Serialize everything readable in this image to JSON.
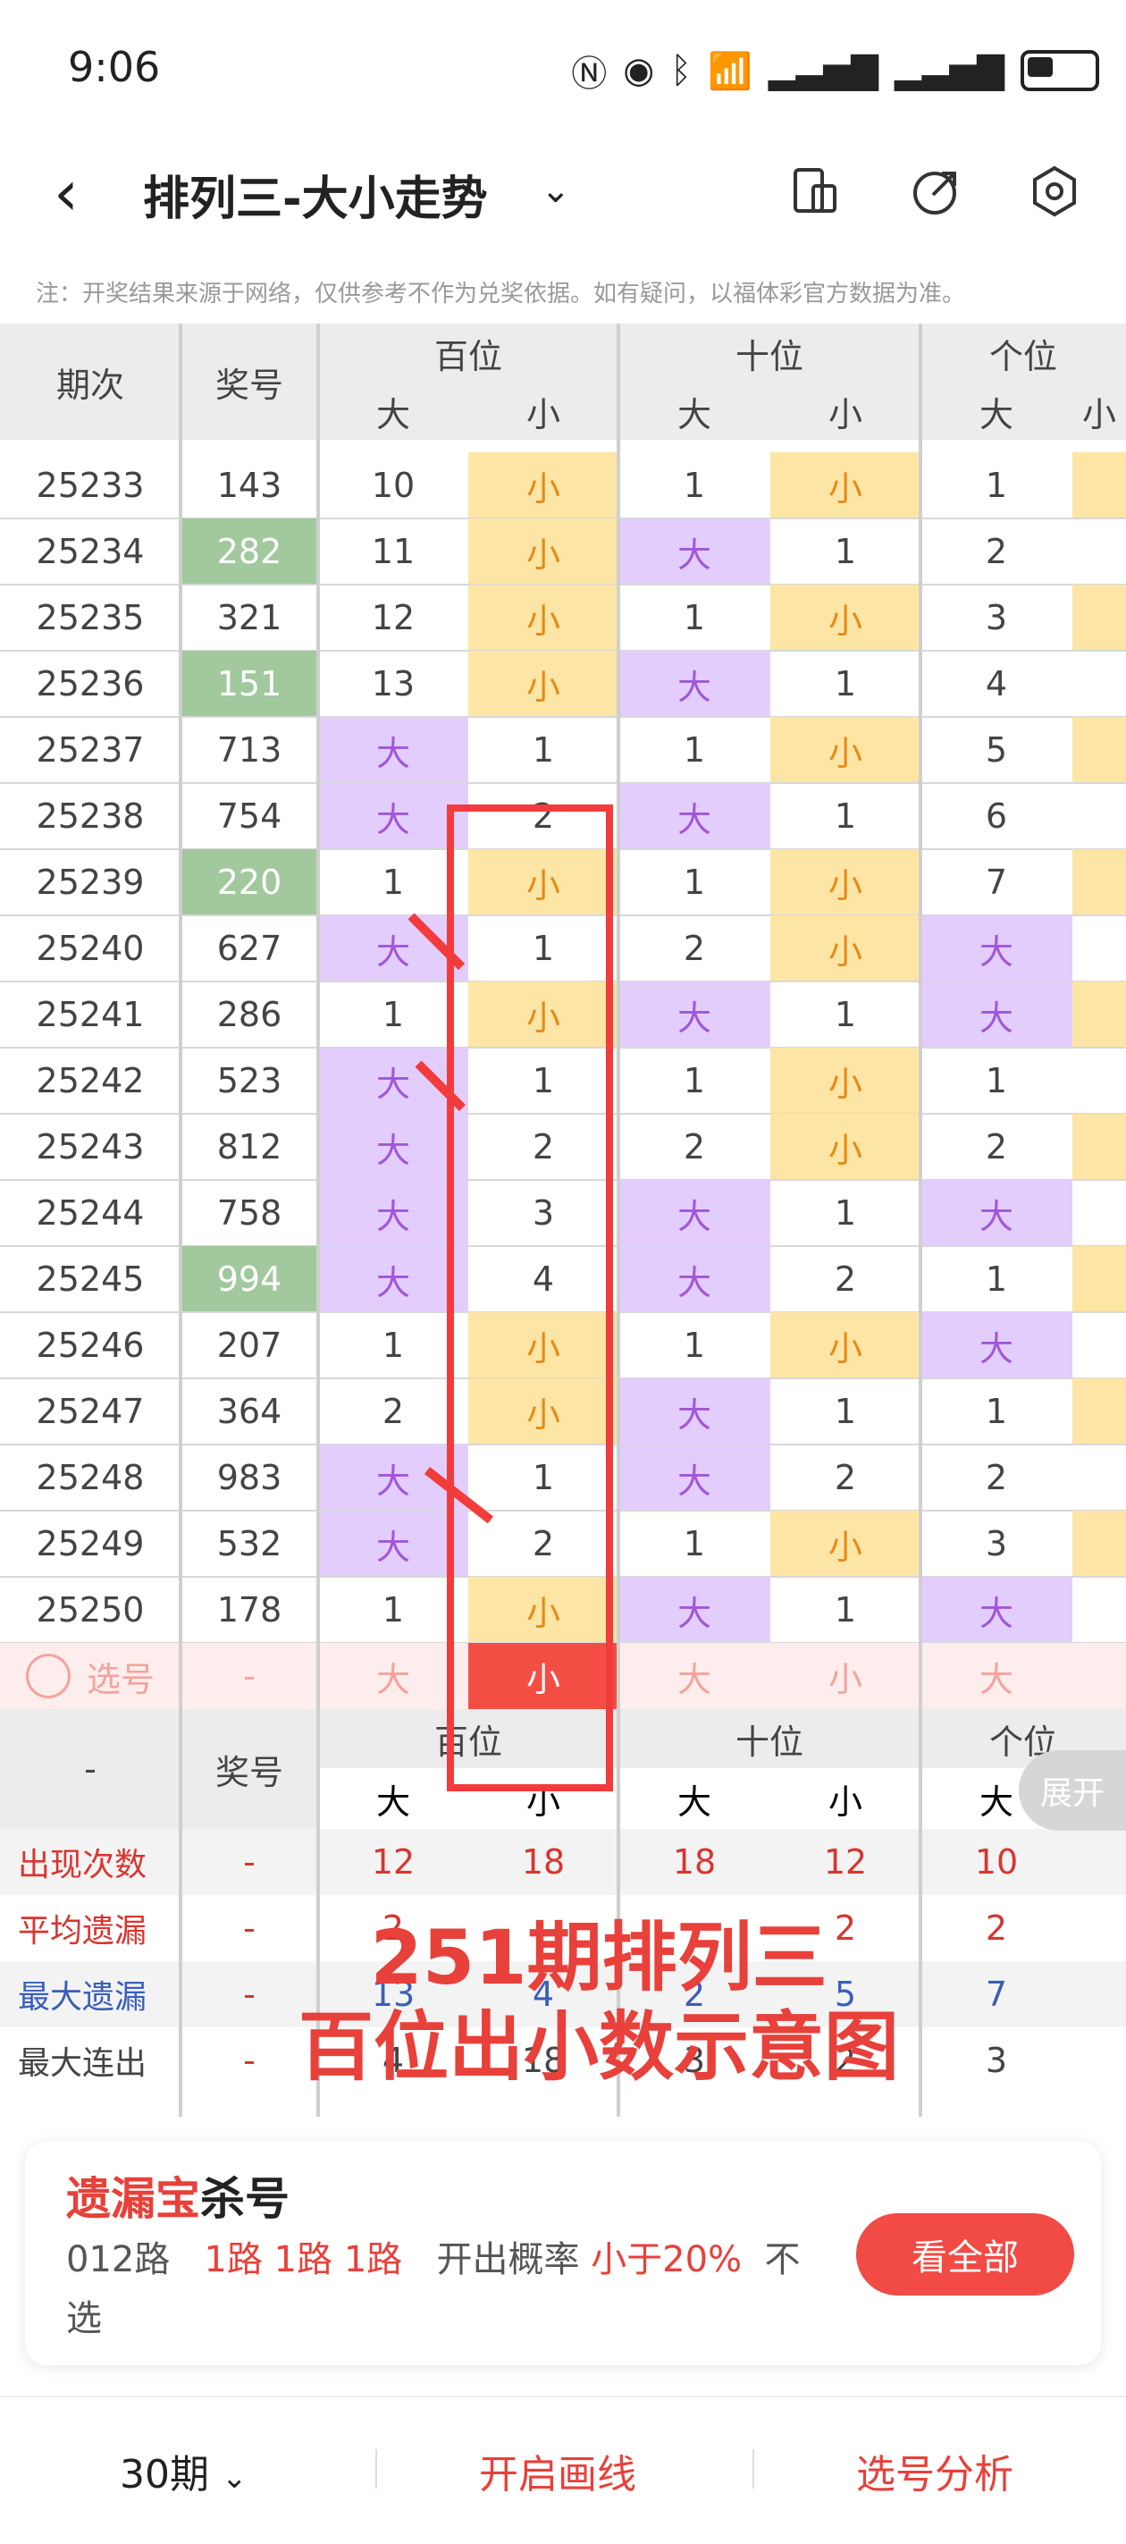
{
  "status": {
    "time": "9:06"
  },
  "header": {
    "title": "排列三-大小走势"
  },
  "notice": "注：开奖结果来源于网络，仅供参考不作为兑奖依据。如有疑问，以福体彩官方数据为准。",
  "table": {
    "col_period": "期次",
    "col_number": "奖号",
    "groups": [
      "百位",
      "十位",
      "个位"
    ],
    "sub_big": "大",
    "sub_small": "小",
    "rows": [
      {
        "p": "25233",
        "n": "143",
        "g": false,
        "c": [
          "10",
          "小",
          "1",
          "小",
          "1",
          ""
        ]
      },
      {
        "p": "25234",
        "n": "282",
        "g": true,
        "c": [
          "11",
          "小",
          "大",
          "1",
          "2",
          ""
        ]
      },
      {
        "p": "25235",
        "n": "321",
        "g": false,
        "c": [
          "12",
          "小",
          "1",
          "小",
          "3",
          ""
        ]
      },
      {
        "p": "25236",
        "n": "151",
        "g": true,
        "c": [
          "13",
          "小",
          "大",
          "1",
          "4",
          ""
        ]
      },
      {
        "p": "25237",
        "n": "713",
        "g": false,
        "c": [
          "大",
          "1",
          "1",
          "小",
          "5",
          ""
        ]
      },
      {
        "p": "25238",
        "n": "754",
        "g": false,
        "c": [
          "大",
          "2",
          "大",
          "1",
          "6",
          ""
        ]
      },
      {
        "p": "25239",
        "n": "220",
        "g": true,
        "c": [
          "1",
          "小",
          "1",
          "小",
          "7",
          ""
        ]
      },
      {
        "p": "25240",
        "n": "627",
        "g": false,
        "c": [
          "大",
          "1",
          "2",
          "小",
          "大",
          ""
        ]
      },
      {
        "p": "25241",
        "n": "286",
        "g": false,
        "c": [
          "1",
          "小",
          "大",
          "1",
          "大",
          ""
        ]
      },
      {
        "p": "25242",
        "n": "523",
        "g": false,
        "c": [
          "大",
          "1",
          "1",
          "小",
          "1",
          ""
        ]
      },
      {
        "p": "25243",
        "n": "812",
        "g": false,
        "c": [
          "大",
          "2",
          "2",
          "小",
          "2",
          ""
        ]
      },
      {
        "p": "25244",
        "n": "758",
        "g": false,
        "c": [
          "大",
          "3",
          "大",
          "1",
          "大",
          ""
        ]
      },
      {
        "p": "25245",
        "n": "994",
        "g": true,
        "c": [
          "大",
          "4",
          "大",
          "2",
          "1",
          ""
        ]
      },
      {
        "p": "25246",
        "n": "207",
        "g": false,
        "c": [
          "1",
          "小",
          "1",
          "小",
          "大",
          ""
        ]
      },
      {
        "p": "25247",
        "n": "364",
        "g": false,
        "c": [
          "2",
          "小",
          "大",
          "1",
          "1",
          ""
        ]
      },
      {
        "p": "25248",
        "n": "983",
        "g": false,
        "c": [
          "大",
          "1",
          "大",
          "2",
          "2",
          ""
        ]
      },
      {
        "p": "25249",
        "n": "532",
        "g": false,
        "c": [
          "大",
          "2",
          "1",
          "小",
          "3",
          ""
        ]
      },
      {
        "p": "25250",
        "n": "178",
        "g": false,
        "c": [
          "1",
          "小",
          "大",
          "1",
          "大",
          ""
        ]
      }
    ],
    "select_row": {
      "label": "选号",
      "dash": "-",
      "cells": [
        "大",
        "小",
        "大",
        "小",
        "大"
      ]
    },
    "footer_header": {
      "dash": "-",
      "number": "奖号"
    },
    "stats": [
      {
        "label": "出现次数",
        "color": "#d8352f",
        "dash": "-",
        "vals": [
          "12",
          "18",
          "18",
          "12",
          "10"
        ]
      },
      {
        "label": "平均遗漏",
        "color": "#d8352f",
        "dash": "-",
        "vals": [
          "2",
          "",
          "",
          "2",
          "2"
        ]
      },
      {
        "label": "最大遗漏",
        "color": "#3a5fb8",
        "dash": "-",
        "vals": [
          "13",
          "4",
          "2",
          "5",
          "7"
        ]
      },
      {
        "label": "最大连出",
        "color": "#444",
        "dash": "-",
        "vals": [
          "4",
          "18",
          "3",
          "2",
          "3"
        ]
      }
    ],
    "expand": "展开"
  },
  "overlay": {
    "line1": "251期排列三",
    "line2": "百位出小数示意图"
  },
  "kill": {
    "title_a": "遗漏宝",
    "title_b": "杀号",
    "route": "012路",
    "routes": "1路 1路 1路",
    "prob_label": "开出概率",
    "prob_val": "小于20%",
    "tail": "不选",
    "button": "看全部"
  },
  "bottombar": {
    "periods": "30期",
    "draw_line": "开启画线",
    "analysis": "选号分析"
  }
}
